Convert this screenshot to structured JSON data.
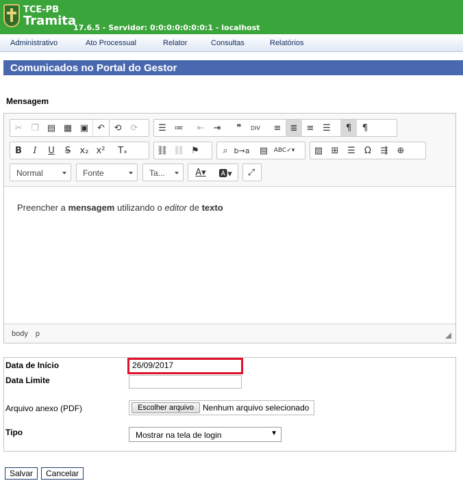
{
  "header": {
    "brand_small": "TCE-PB",
    "brand_main": "Tramita",
    "version_line": "17.6.5 - Servidor: 0:0:0:0:0:0:0:1 - localhost",
    "bg_color": "#3aa53a"
  },
  "menu": {
    "items": [
      "Administrativo",
      "Ato Processual",
      "Relator",
      "Consultas",
      "Relatórios"
    ]
  },
  "page": {
    "title": "Comunicados no Portal do Gestor",
    "section_label": "Mensagem"
  },
  "editor": {
    "toolbar_row1": [
      "cut-icon",
      "copy-icon",
      "paste-icon",
      "paste-text-icon",
      "paste-word-icon",
      "undo-icon",
      "redo-icon",
      "numbered-list-icon",
      "bulleted-list-icon",
      "outdent-icon",
      "indent-icon",
      "blockquote-icon",
      "div-icon",
      "align-left-icon",
      "align-center-icon",
      "align-right-icon",
      "justify-icon",
      "ltr-icon",
      "rtl-icon"
    ],
    "combos": {
      "format": "Normal",
      "font": "Fonte",
      "size": "Ta..."
    },
    "content": {
      "t1": "Preencher a ",
      "b1": "mensagem",
      "t2": " utilizando o ",
      "i1": "editor",
      "t3": " de ",
      "b2": "texto"
    },
    "path": [
      "body",
      "p"
    ]
  },
  "form": {
    "start_label": "Data de Início",
    "start_value": "26/09/2017",
    "limit_label": "Data Limite",
    "limit_value": "",
    "attach_label": "Arquivo anexo (PDF)",
    "file_button": "Escolher arquivo",
    "file_status": "Nenhum arquivo selecionado",
    "type_label": "Tipo",
    "type_value": "Mostrar na tela de login",
    "highlight_color": "#e0112b"
  },
  "actions": {
    "save": "Salvar",
    "cancel": "Cancelar"
  }
}
